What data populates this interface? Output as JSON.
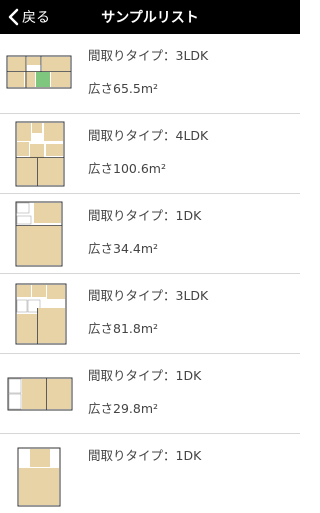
{
  "navbar": {
    "back_label": "戻る",
    "title": "サンプルリスト"
  },
  "rows": [
    {
      "type": "間取りタイプ：3LDK",
      "area": "広さ65.5m²"
    },
    {
      "type": "間取りタイプ：4LDK",
      "area": "広さ100.6m²"
    },
    {
      "type": "間取りタイプ：1DK",
      "area": "広さ34.4m²"
    },
    {
      "type": "間取りタイプ：3LDK",
      "area": "広さ81.8m²"
    },
    {
      "type": "間取りタイプ：1DK",
      "area": "広さ29.8m²"
    },
    {
      "type": "間取りタイプ：1DK",
      "area": ""
    }
  ],
  "colors": {
    "navbar_bg": "#000000",
    "floor": "#e8d3a6",
    "wall": "#333333",
    "separator": "#d6d6d6",
    "green_room": "#7fc77f"
  }
}
